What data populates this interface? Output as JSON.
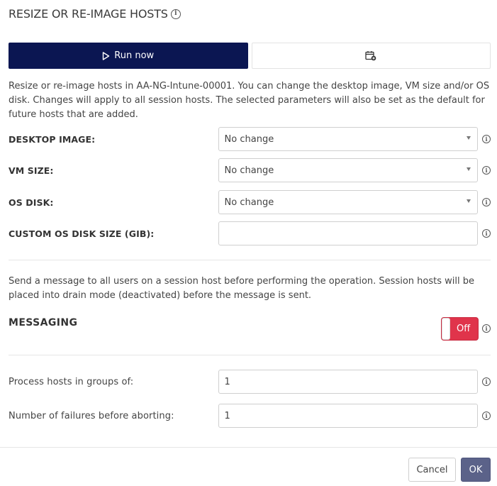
{
  "dialog": {
    "title": "RESIZE OR RE-IMAGE HOSTS"
  },
  "tabs": [
    {
      "label": "Run now",
      "icon": "play-icon",
      "active": true
    },
    {
      "label": "",
      "icon": "calendar-add-icon",
      "active": false
    }
  ],
  "description": "Resize or re-image hosts in AA-NG-Intune-00001. You can change the desktop image, VM size and/or OS disk. Changes will apply to all session hosts. The selected parameters will also be set as the default for future hosts that are added.",
  "fields": {
    "desktop_image": {
      "label": "DESKTOP IMAGE:",
      "value": "No change"
    },
    "vm_size": {
      "label": "VM SIZE:",
      "value": "No change"
    },
    "os_disk": {
      "label": "OS DISK:",
      "value": "No change"
    },
    "custom_os_disk_size": {
      "label": "CUSTOM OS DISK SIZE (GIB):",
      "value": ""
    }
  },
  "messaging": {
    "description": "Send a message to all users on a session host before performing the operation. Session hosts will be placed into drain mode (deactivated) before the message is sent.",
    "label": "MESSAGING",
    "toggle_text": "Off",
    "toggle_color": "#e0344b"
  },
  "processing": {
    "groups": {
      "label": "Process hosts in groups of:",
      "value": "1"
    },
    "failures": {
      "label": "Number of failures before aborting:",
      "value": "1"
    }
  },
  "footer": {
    "cancel_label": "Cancel",
    "ok_label": "OK"
  },
  "colors": {
    "primary": "#0b1652",
    "ok_button": "#5b6289",
    "toggle_off": "#e0344b"
  }
}
